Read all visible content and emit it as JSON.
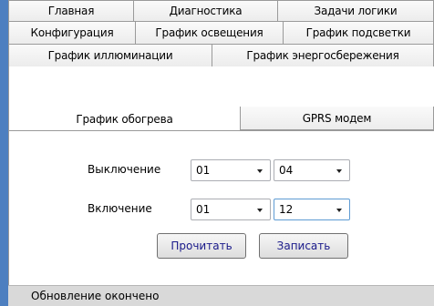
{
  "tabs": {
    "row1": [
      "Главная",
      "Диагностика",
      "Задачи логики"
    ],
    "row2": [
      "Конфигурация",
      "График освещения",
      "График подсветки"
    ],
    "row3": [
      "График иллюминации",
      "График энергосбережения"
    ],
    "row4": [
      "График обогрева",
      "GPRS модем"
    ],
    "active": "График обогрева"
  },
  "form": {
    "off_label": "Выключение",
    "on_label": "Включение",
    "off_hour": "01",
    "off_minute": "04",
    "on_hour": "01",
    "on_minute": "12"
  },
  "buttons": {
    "read": "Прочитать",
    "write": "Записать"
  },
  "status": "Обновление окончено",
  "colors": {
    "accent_strip": "#4d7fc0",
    "focus_border": "#5e9bd3"
  }
}
